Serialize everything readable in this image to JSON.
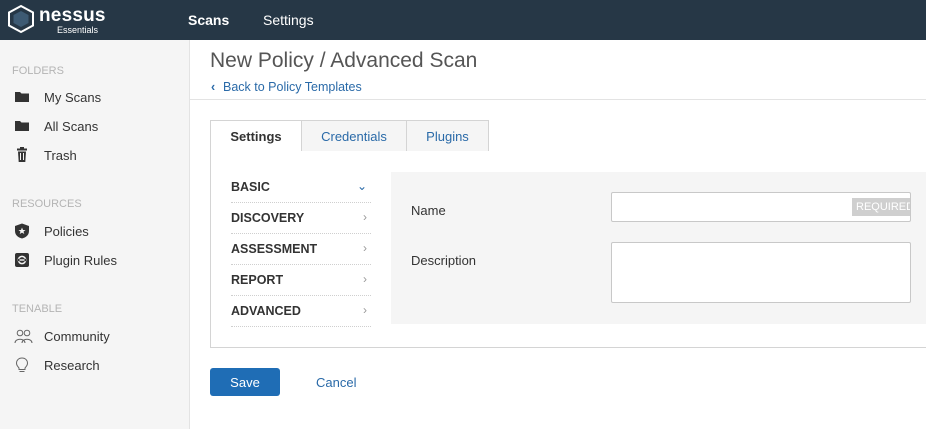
{
  "app": {
    "logo_name": "nessus",
    "logo_sub": "Essentials"
  },
  "topnav": {
    "scans": "Scans",
    "settings": "Settings"
  },
  "sidebar": {
    "folders_head": "FOLDERS",
    "folders": [
      {
        "label": "My Scans",
        "icon": "folder-icon"
      },
      {
        "label": "All Scans",
        "icon": "folder-icon"
      },
      {
        "label": "Trash",
        "icon": "trash-icon"
      }
    ],
    "resources_head": "RESOURCES",
    "resources": [
      {
        "label": "Policies",
        "icon": "shield-icon"
      },
      {
        "label": "Plugin Rules",
        "icon": "plugin-rules-icon"
      }
    ],
    "tenable_head": "TENABLE",
    "tenable": [
      {
        "label": "Community",
        "icon": "community-icon"
      },
      {
        "label": "Research",
        "icon": "lightbulb-icon"
      }
    ]
  },
  "page": {
    "title": "New Policy / Advanced Scan",
    "back_link": "Back to Policy Templates"
  },
  "tabs": [
    {
      "label": "Settings",
      "active": true
    },
    {
      "label": "Credentials",
      "active": false
    },
    {
      "label": "Plugins",
      "active": false
    }
  ],
  "settings_menu": [
    {
      "label": "BASIC",
      "expanded": true
    },
    {
      "label": "DISCOVERY",
      "expanded": false
    },
    {
      "label": "ASSESSMENT",
      "expanded": false
    },
    {
      "label": "REPORT",
      "expanded": false
    },
    {
      "label": "ADVANCED",
      "expanded": false
    }
  ],
  "form": {
    "name_label": "Name",
    "name_value": "",
    "name_required_badge": "REQUIRED",
    "description_label": "Description",
    "description_value": ""
  },
  "actions": {
    "save": "Save",
    "cancel": "Cancel"
  },
  "colors": {
    "topbar": "#263746",
    "accent": "#1f6db5",
    "link": "#2a6aa8"
  }
}
